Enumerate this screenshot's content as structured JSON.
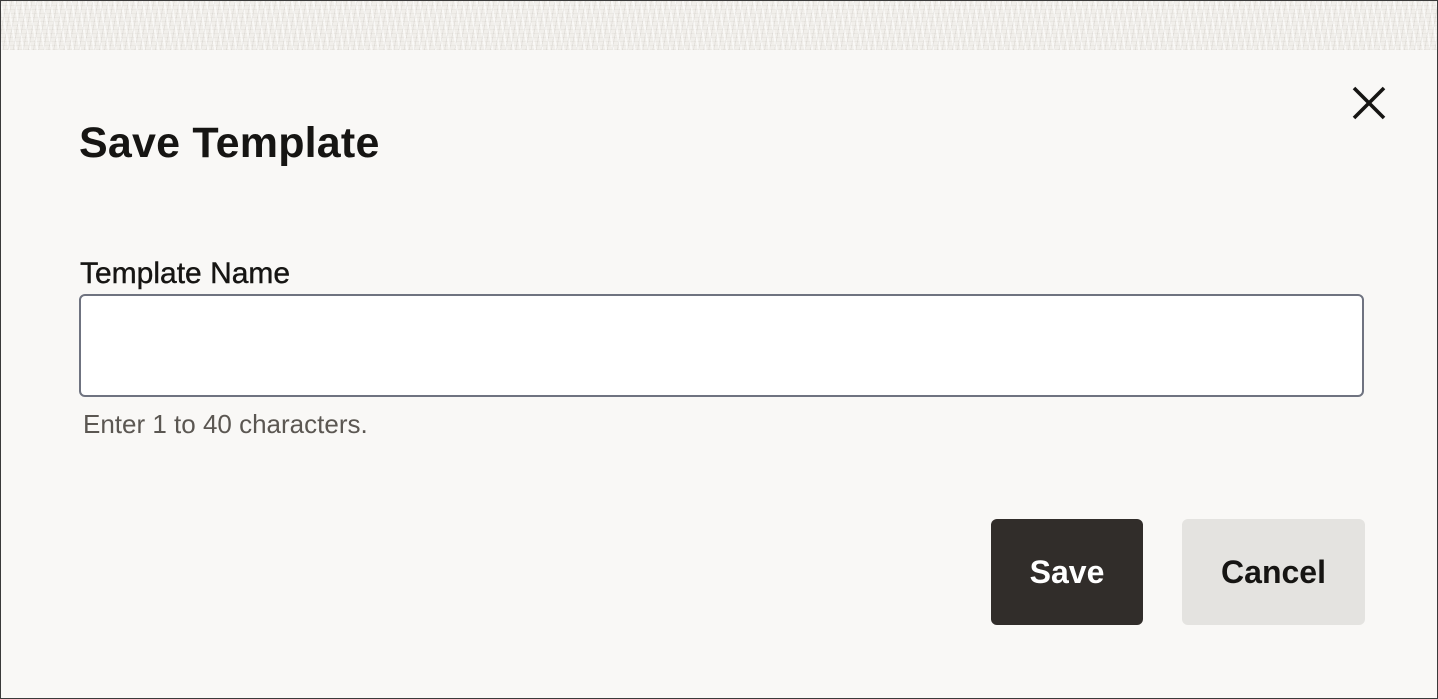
{
  "dialog": {
    "title": "Save Template",
    "close_icon": "close-icon"
  },
  "form": {
    "template_name": {
      "label": "Template Name",
      "value": "",
      "placeholder": "",
      "help_text": "Enter 1 to 40 characters."
    }
  },
  "actions": {
    "save_label": "Save",
    "cancel_label": "Cancel"
  },
  "colors": {
    "background": "#f9f8f6",
    "primary_button": "#312d2a",
    "secondary_button": "#e4e3e0",
    "input_border": "#6f7380",
    "text": "#161513",
    "help_text": "#5b5752"
  }
}
